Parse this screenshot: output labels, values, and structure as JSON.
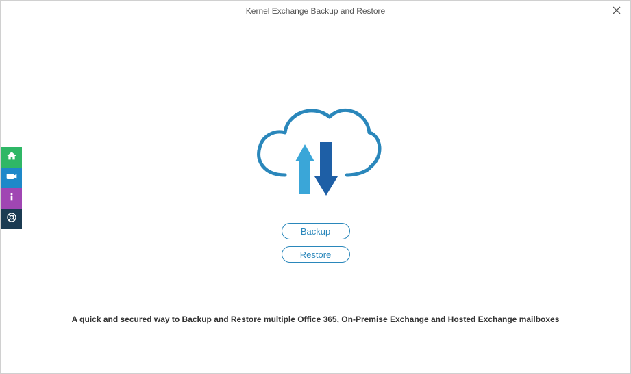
{
  "window": {
    "title": "Kernel Exchange Backup and Restore"
  },
  "sidebar": {
    "items": [
      {
        "name": "home"
      },
      {
        "name": "video"
      },
      {
        "name": "info"
      },
      {
        "name": "help"
      }
    ]
  },
  "actions": {
    "backup_label": "Backup",
    "restore_label": "Restore"
  },
  "tagline": "A quick and secured way to Backup and Restore multiple Office 365, On-Premise Exchange and Hosted Exchange mailboxes"
}
